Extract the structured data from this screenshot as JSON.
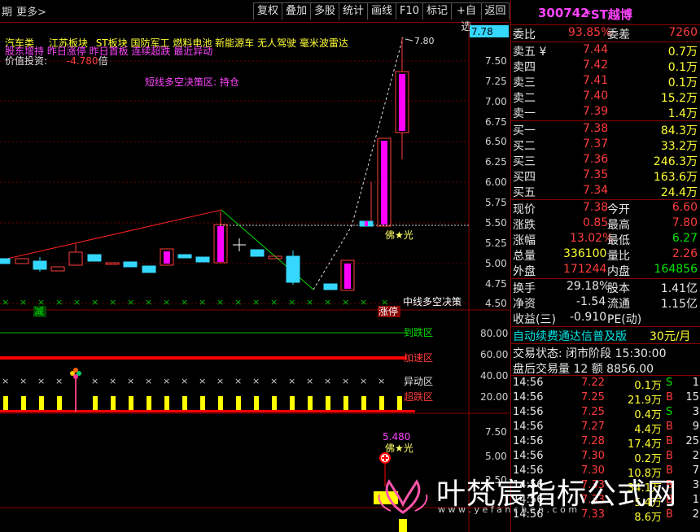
{
  "toolbar": {
    "left_items": [
      "期",
      "更多>"
    ],
    "buttons": [
      "复权",
      "叠加",
      "多股",
      "统计",
      "画线",
      "F10",
      "标记",
      "+自选",
      "返回"
    ]
  },
  "indicators": {
    "line1_cats": [
      "汽车类",
      "江苏板块",
      "ST板块",
      "国防军工",
      "燃料电池",
      "新能源车",
      "无人驾驶",
      "毫米波雷达"
    ],
    "line2": "股东增持 昨日涨停 昨日首板 连续超跌 最近异动",
    "value_label": "价值投资:",
    "value_num": "-4.780",
    "value_unit": "倍",
    "strategy": "短线多空决策区: 持仓",
    "peak_label": "7.80",
    "buddha": "佛★光",
    "mid_strategy": "中线多空决策",
    "tag_jian": "减",
    "tag_zhangting": "涨停"
  },
  "price_axis": [
    "7.50",
    "7.25",
    "7.00",
    "6.75",
    "6.50",
    "6.25",
    "6.00",
    "5.75",
    "5.50",
    "5.25",
    "5.00",
    "4.75",
    "4.50"
  ],
  "current_price_tag": "7.78",
  "zone_labels": {
    "zone1": "到跌区",
    "zone2": "加速区",
    "zone3": "异动区",
    "zone4": "超跌区"
  },
  "mid_axis": [
    "80.00",
    "60.00",
    "40.00",
    "20.00"
  ],
  "bottom": {
    "value": "5.480",
    "buddha": "佛★光",
    "axis": [
      "7.50",
      "5.00",
      "2.50"
    ]
  },
  "stock": {
    "code": "300742",
    "name": "*ST越博"
  },
  "book": {
    "weibi_label": "委比",
    "weibi_value": "93.85%",
    "weicha_label": "委差",
    "weicha_value": "7260",
    "sells": [
      {
        "label": "卖五 ¥",
        "price": "7.44",
        "vol": "0.7万"
      },
      {
        "label": "卖四",
        "price": "7.42",
        "vol": "0.1万"
      },
      {
        "label": "卖三",
        "price": "7.41",
        "vol": "0.1万"
      },
      {
        "label": "卖二",
        "price": "7.40",
        "vol": "15.2万"
      },
      {
        "label": "卖一",
        "price": "7.39",
        "vol": "1.4万"
      }
    ],
    "buys": [
      {
        "label": "买一",
        "price": "7.38",
        "vol": "84.3万"
      },
      {
        "label": "买二",
        "price": "7.37",
        "vol": "33.2万"
      },
      {
        "label": "买三",
        "price": "7.36",
        "vol": "246.3万"
      },
      {
        "label": "买四",
        "price": "7.35",
        "vol": "163.6万"
      },
      {
        "label": "买五",
        "price": "7.34",
        "vol": "24.4万"
      }
    ]
  },
  "quote": {
    "rows": [
      {
        "l1": "现价",
        "v1": "7.38",
        "l2": "今开",
        "v2": "6.60",
        "c1": "red",
        "c2": "red"
      },
      {
        "l1": "涨跌",
        "v1": "0.85",
        "l2": "最高",
        "v2": "7.80",
        "c1": "red",
        "c2": "red"
      },
      {
        "l1": "涨幅",
        "v1": "13.02%",
        "l2": "最低",
        "v2": "6.27",
        "c1": "red",
        "c2": "green"
      },
      {
        "l1": "总量",
        "v1": "336100",
        "l2": "量比",
        "v2": "2.26",
        "c1": "yellow",
        "c2": "red"
      },
      {
        "l1": "外盘",
        "v1": "171244",
        "l2": "内盘",
        "v2": "164856",
        "c1": "red",
        "c2": "green"
      }
    ],
    "rows2": [
      {
        "l1": "换手",
        "v1": "29.18%",
        "l2": "股本",
        "v2": "1.41亿"
      },
      {
        "l1": "净资",
        "v1": "-1.54",
        "l2": "流通",
        "v2": "1.15亿"
      },
      {
        "l1": "收益(三)",
        "v1": "-0.910",
        "l2": "PE(动)",
        "v2": ""
      }
    ]
  },
  "promo": {
    "text": "自动续费通达信普及版",
    "price": "30元/月"
  },
  "status": {
    "trade_state": "交易状态: 闭市阶段 15:30:00",
    "after_hours": "盘后交易量 12 额 8856.00"
  },
  "ticks": [
    {
      "time": "14:56",
      "price": "7.22",
      "vol": "0.1万",
      "bs": "S",
      "n": "1"
    },
    {
      "time": "14:56",
      "price": "7.25",
      "vol": "21.9万",
      "bs": "B",
      "n": "15"
    },
    {
      "time": "14:56",
      "price": "7.25",
      "vol": "0.4万",
      "bs": "S",
      "n": "3"
    },
    {
      "time": "14:56",
      "price": "7.27",
      "vol": "4.4万",
      "bs": "B",
      "n": "9"
    },
    {
      "time": "14:56",
      "price": "7.28",
      "vol": "17.4万",
      "bs": "B",
      "n": "25"
    },
    {
      "time": "14:56",
      "price": "7.30",
      "vol": "0.2万",
      "bs": "B",
      "n": "2"
    },
    {
      "time": "14:56",
      "price": "7.30",
      "vol": "10.8万",
      "bs": "B",
      "n": "7"
    },
    {
      "time": "14:56",
      "price": "7.33",
      "vol": "34.1万",
      "bs": "B",
      "n": "3"
    },
    {
      "time": "14:56",
      "price": "7.33",
      "vol": "5.4万",
      "bs": "B",
      "n": "1"
    },
    {
      "time": "14:56",
      "price": "7.33",
      "vol": "8.6万",
      "bs": "B",
      "n": "2"
    }
  ],
  "watermark": {
    "title": "叶梵宸指标公式网",
    "url": "w w w . y e f a n c h e n . c o m"
  },
  "colors": {
    "up": "#ff3c3c",
    "down": "#35d7ff",
    "panel_border": "#8a0000",
    "magenta": "#ff00ff",
    "yellow": "#ffff33"
  }
}
